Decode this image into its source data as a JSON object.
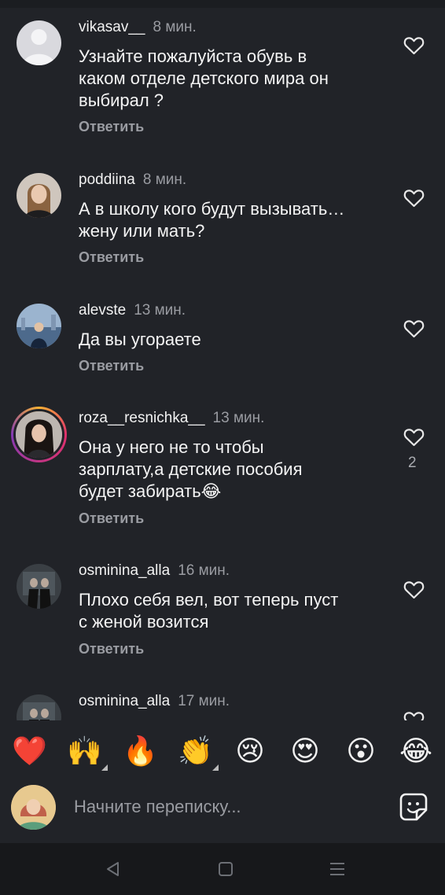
{
  "comments": [
    {
      "username": "vikasav__",
      "time": "8 мин.",
      "text": [
        "Узнайте пожалуйста обувь в",
        "каком отделе детского мира он",
        "выбирал ?"
      ],
      "reply": "Ответить",
      "likes": ""
    },
    {
      "username": "poddiina",
      "time": "8 мин.",
      "text": [
        "А в школу кого будут вызывать…",
        "жену или мать?"
      ],
      "reply": "Ответить",
      "likes": ""
    },
    {
      "username": "alevste",
      "time": "13 мин.",
      "text": [
        "Да вы угораете"
      ],
      "reply": "Ответить",
      "likes": ""
    },
    {
      "username": "roza__resnichka__",
      "time": "13 мин.",
      "text": [
        "Она у него не то чтобы",
        "зарплату,а детские пособия",
        "будет забирать😂"
      ],
      "reply": "Ответить",
      "likes": "2"
    },
    {
      "username": "osminina_alla",
      "time": "16 мин.",
      "text": [
        "Плохо себя вел, вот теперь пуст",
        "с женой возится"
      ],
      "reply": "Ответить",
      "likes": ""
    },
    {
      "username": "osminina_alla",
      "time": "17 мин.",
      "text": [],
      "reply": "",
      "likes": ""
    }
  ],
  "emoji_bar": [
    "❤️",
    "🙌",
    "🔥",
    "👏",
    "😢",
    "😍",
    "😮",
    "😂"
  ],
  "composer": {
    "placeholder": "Начните переписку..."
  },
  "colors": {
    "background": "#212328",
    "muted": "#9a9ca2",
    "heart": "#e8e8e8",
    "navbar": "#17181b"
  },
  "icons": {
    "like": "heart-outline-icon",
    "sticker": "sticker-icon",
    "back": "back-triangle-icon",
    "home": "home-square-icon",
    "recents": "recents-lines-icon"
  }
}
